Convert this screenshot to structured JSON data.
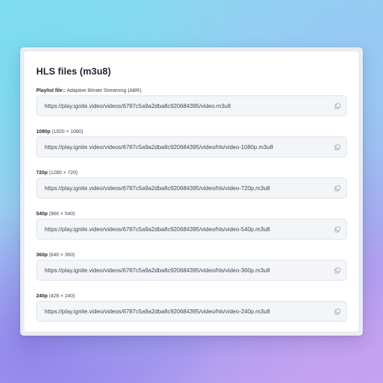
{
  "card": {
    "title": "HLS files (m3u8)"
  },
  "fields": [
    {
      "label_bold": "Playlist file::",
      "label_detail": "Adaptive Bitrate Streaming (ABR)",
      "url": "https://play.ignite.video/videos/6787c5a9a2dba8c920684395/video.m3u8",
      "icon": "copy-icon"
    },
    {
      "label_bold": "1080p",
      "label_detail": "(1920 × 1080)",
      "url": "https://play.ignite.video/videos/6787c5a9a2dba8c920684395/video/hls/video-1080p.m3u8",
      "icon": "copy-icon"
    },
    {
      "label_bold": "720p",
      "label_detail": "(1280 × 720)",
      "url": "https://play.ignite.video/videos/6787c5a9a2dba8c920684395/video/hls/video-720p.m3u8",
      "icon": "copy-icon"
    },
    {
      "label_bold": "540p",
      "label_detail": "(960 × 540)",
      "url": "https://play.ignite.video/videos/6787c5a9a2dba8c920684395/video/hls/video-540p.m3u8",
      "icon": "copy-icon"
    },
    {
      "label_bold": "360p",
      "label_detail": "(640 × 360)",
      "url": "https://play.ignite.video/videos/6787c5a9a2dba8c920684395/video/hls/video-360p.m3u8",
      "icon": "copy-icon"
    },
    {
      "label_bold": "240p",
      "label_detail": "(428 × 240)",
      "url": "https://play.ignite.video/videos/6787c5a9a2dba8c920684395/video/hls/video-240p.m3u8",
      "icon": "copy-icon"
    }
  ]
}
